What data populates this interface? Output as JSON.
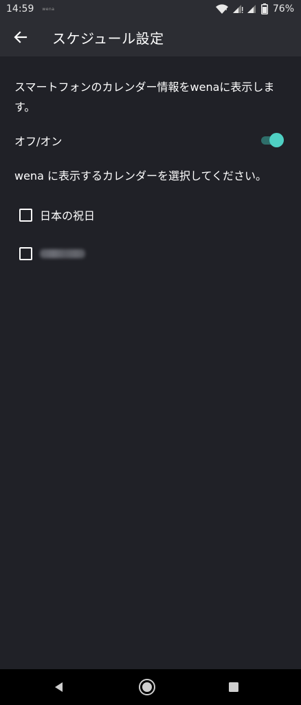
{
  "status_bar": {
    "time": "14:59",
    "notification_text": "wena",
    "battery_percent": "76%",
    "icons": [
      "wifi-icon",
      "signal-icon",
      "signal-icon",
      "battery-icon"
    ]
  },
  "app_bar": {
    "back_icon": "arrow-left-icon",
    "title": "スケジュール設定"
  },
  "content": {
    "description": "スマートフォンのカレンダー情報をwenaに表示します。",
    "toggle": {
      "label": "オフ/オン",
      "checked": true
    },
    "select_prompt": "wena に表示するカレンダーを選択してください。",
    "calendars": [
      {
        "label": "日本の祝日",
        "checked": false,
        "blurred": false
      },
      {
        "label": "",
        "checked": false,
        "blurred": true
      }
    ]
  },
  "colors": {
    "background": "#202127",
    "app_bar": "#2c2d33",
    "toggle_thumb": "#4fd0c3",
    "toggle_track": "#2e6e6a",
    "text": "#ffffff"
  },
  "nav_bar": {
    "buttons": [
      "back-triangle-icon",
      "home-circle-icon",
      "recents-square-icon"
    ]
  }
}
